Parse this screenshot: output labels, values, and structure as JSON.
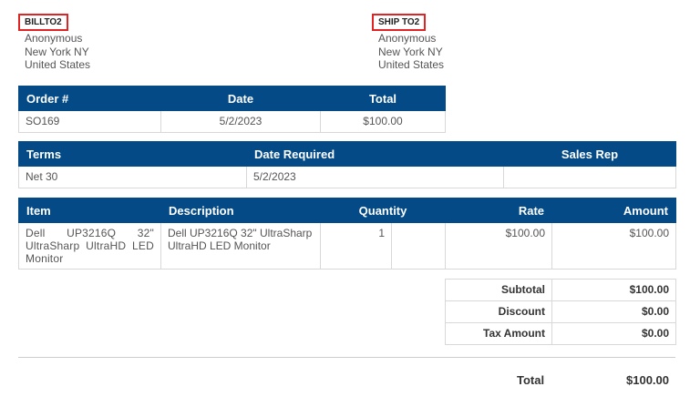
{
  "bill_to": {
    "label": "BILLTO2",
    "name": "Anonymous",
    "city": "New York NY",
    "country": "United States"
  },
  "ship_to": {
    "label": "SHIP TO2",
    "name": "Anonymous",
    "city": "New York NY",
    "country": "United States"
  },
  "order": {
    "headers": [
      "Order #",
      "Date",
      "Total"
    ],
    "row": [
      "SO169",
      "5/2/2023",
      "$100.00"
    ]
  },
  "terms": {
    "headers": [
      "Terms",
      "Date Required",
      "Sales Rep"
    ],
    "row": [
      "Net 30",
      "5/2/2023",
      ""
    ]
  },
  "items": {
    "headers": [
      "Item",
      "Description",
      "Quantity",
      "",
      "Rate",
      "Amount"
    ],
    "rows": [
      {
        "item": "Dell UP3216Q 32\" UltraSharp UltraHD LED Monitor",
        "description": "Dell UP3216Q 32\" UltraSharp UltraHD LED Monitor",
        "quantity": "1",
        "extra": "",
        "rate": "$100.00",
        "amount": "$100.00"
      }
    ]
  },
  "totals": {
    "subtotal_label": "Subtotal",
    "subtotal_value": "$100.00",
    "discount_label": "Discount",
    "discount_value": "$0.00",
    "tax_label": "Tax Amount",
    "tax_value": "$0.00",
    "total_label": "Total",
    "total_value": "$100.00"
  },
  "colors": {
    "header_bg": "#034a86",
    "highlight_border": "#e02424"
  }
}
